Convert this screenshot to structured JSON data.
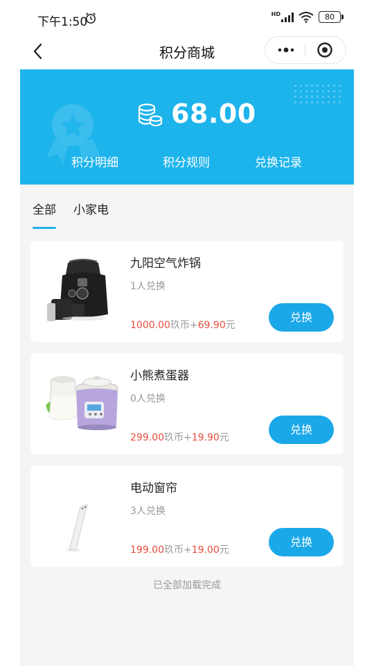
{
  "status_bar": {
    "time": "下午1:50",
    "network": "HD",
    "battery": "80"
  },
  "navbar": {
    "title": "积分商城"
  },
  "banner": {
    "points": "68.00",
    "links": [
      "积分明细",
      "积分规则",
      "兑换记录"
    ]
  },
  "tabs": [
    {
      "label": "全部",
      "active": true
    },
    {
      "label": "小家电",
      "active": false
    }
  ],
  "products": [
    {
      "name": "九阳空气炸锅",
      "count": "1人兑换",
      "points_price": "1000.00",
      "points_unit": "玖币+",
      "cash_price": "69.90",
      "cash_unit": "元",
      "button": "兑换"
    },
    {
      "name": "小熊煮蛋器",
      "count": "0人兑换",
      "points_price": "299.00",
      "points_unit": "玖币+",
      "cash_price": "19.90",
      "cash_unit": "元",
      "button": "兑换"
    },
    {
      "name": "电动窗帘",
      "count": "3人兑换",
      "points_price": "199.00",
      "points_unit": "玖币+",
      "cash_price": "19.00",
      "cash_unit": "元",
      "button": "兑换"
    }
  ],
  "footer": {
    "note": "已全部加载完成"
  },
  "colors": {
    "accent": "#1db4ec",
    "button": "#1ba8e8",
    "price_red": "#e74c3c",
    "background": "#f5f5f5"
  }
}
